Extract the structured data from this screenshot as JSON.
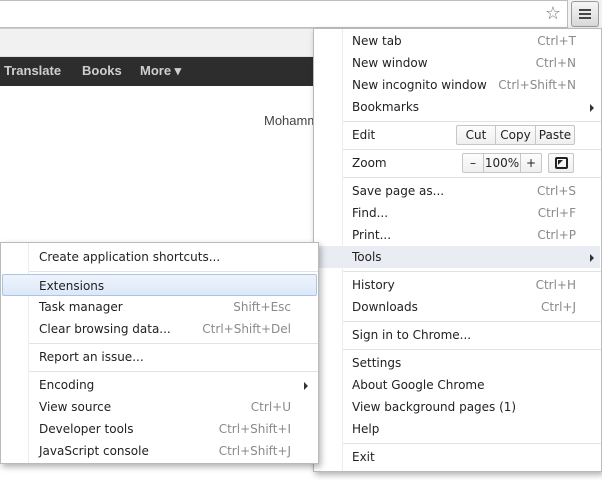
{
  "page": {
    "nav": [
      "Translate",
      "Books",
      "More ▾"
    ],
    "user_name": "Mohamm"
  },
  "main_menu": {
    "new_tab": {
      "label": "New tab",
      "shortcut": "Ctrl+T"
    },
    "new_window": {
      "label": "New window",
      "shortcut": "Ctrl+N"
    },
    "new_incognito": {
      "label": "New incognito window",
      "shortcut": "Ctrl+Shift+N"
    },
    "bookmarks": {
      "label": "Bookmarks"
    },
    "edit": {
      "label": "Edit",
      "cut": "Cut",
      "copy": "Copy",
      "paste": "Paste"
    },
    "zoom": {
      "label": "Zoom",
      "minus": "–",
      "value": "100%",
      "plus": "+"
    },
    "save_page": {
      "label": "Save page as...",
      "shortcut": "Ctrl+S"
    },
    "find": {
      "label": "Find...",
      "shortcut": "Ctrl+F"
    },
    "print": {
      "label": "Print...",
      "shortcut": "Ctrl+P"
    },
    "tools": {
      "label": "Tools"
    },
    "history": {
      "label": "History",
      "shortcut": "Ctrl+H"
    },
    "downloads": {
      "label": "Downloads",
      "shortcut": "Ctrl+J"
    },
    "sign_in": {
      "label": "Sign in to Chrome..."
    },
    "settings": {
      "label": "Settings"
    },
    "about": {
      "label": "About Google Chrome"
    },
    "background_pages": {
      "label": "View background pages (1)"
    },
    "help": {
      "label": "Help"
    },
    "exit": {
      "label": "Exit"
    }
  },
  "tools_menu": {
    "create_shortcuts": {
      "label": "Create application shortcuts..."
    },
    "extensions": {
      "label": "Extensions"
    },
    "task_manager": {
      "label": "Task manager",
      "shortcut": "Shift+Esc"
    },
    "clear_data": {
      "label": "Clear browsing data...",
      "shortcut": "Ctrl+Shift+Del"
    },
    "report_issue": {
      "label": "Report an issue..."
    },
    "encoding": {
      "label": "Encoding"
    },
    "view_source": {
      "label": "View source",
      "shortcut": "Ctrl+U"
    },
    "dev_tools": {
      "label": "Developer tools",
      "shortcut": "Ctrl+Shift+I"
    },
    "js_console": {
      "label": "JavaScript console",
      "shortcut": "Ctrl+Shift+J"
    }
  },
  "icons": {
    "bookmark_star": "star-outline",
    "menu": "hamburger",
    "fullscreen": "fullscreen-square"
  }
}
